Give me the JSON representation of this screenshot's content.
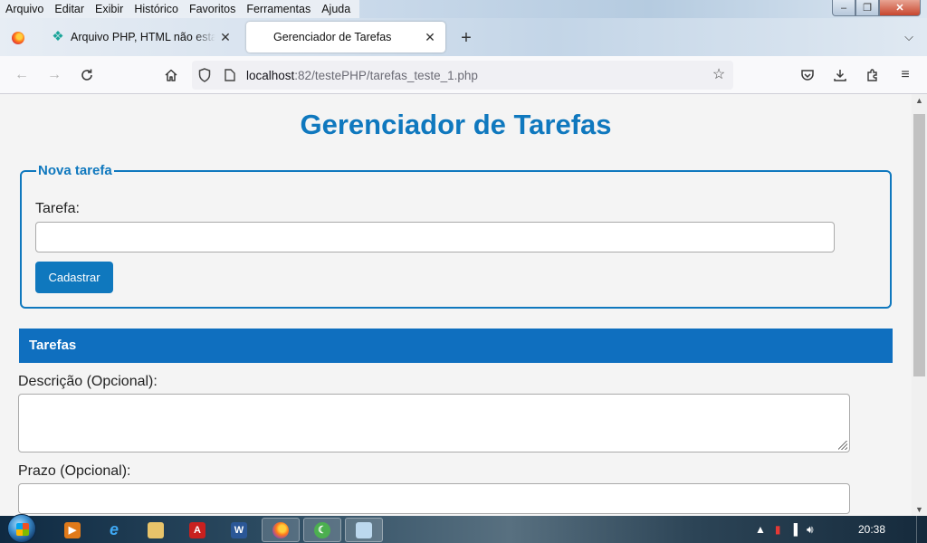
{
  "menubar": {
    "items": [
      "Arquivo",
      "Editar",
      "Exibir",
      "Histórico",
      "Favoritos",
      "Ferramentas",
      "Ajuda"
    ]
  },
  "tabs": [
    {
      "title": "Arquivo PHP, HTML não esta Re",
      "icon": "site-favicon",
      "active": false
    },
    {
      "title": "Gerenciador de Tarefas",
      "icon": "none",
      "active": true
    }
  ],
  "navbar": {
    "url_host": "localhost",
    "url_path": ":82/testePHP/tarefas_teste_1.php"
  },
  "page": {
    "title": "Gerenciador de Tarefas",
    "form": {
      "legend": "Nova tarefa",
      "task_label": "Tarefa:",
      "task_value": "",
      "submit_label": "Cadastrar"
    },
    "section_header": "Tarefas",
    "desc_label": "Descrição (Opcional):",
    "desc_value": "",
    "prazo_label": "Prazo (Opcional):",
    "prazo_value": ""
  },
  "taskbar": {
    "clock": "20:38"
  },
  "colors": {
    "accent": "#0f78be",
    "header_bar": "#0f6fbf",
    "page_bg": "#f4f4f4"
  }
}
